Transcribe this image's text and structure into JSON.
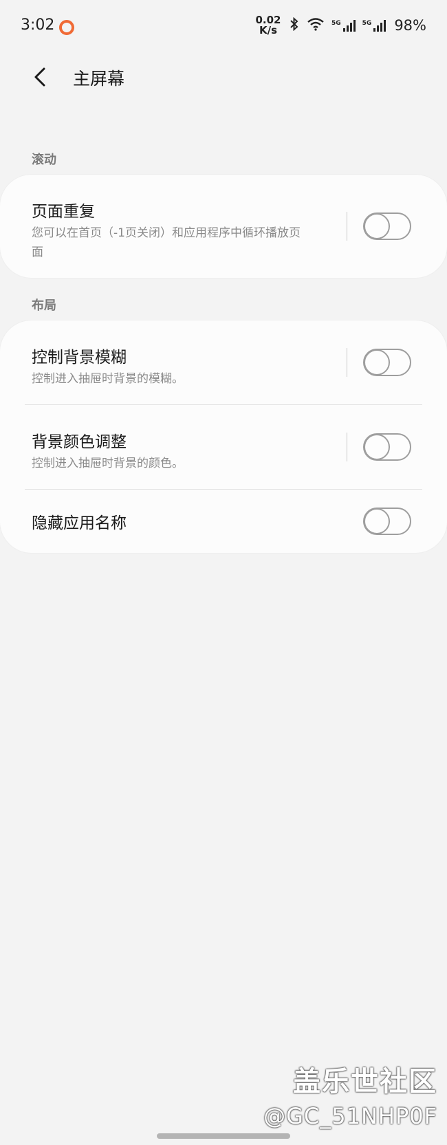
{
  "status_bar": {
    "time": "3:02",
    "net_speed_value": "0.02",
    "net_speed_unit": "K/s",
    "signal1_label": "5G",
    "signal2_label": "5G",
    "battery": "98%",
    "notification_icon": "ring-notification-icon",
    "accent_color": "#f06a35"
  },
  "header": {
    "title": "主屏幕",
    "back_icon": "chevron-left-icon"
  },
  "sections": [
    {
      "label": "滚动",
      "items": [
        {
          "title": "页面重复",
          "desc_line1": "您可以在首页（-1页关闭）和应用程序中循环播放页",
          "desc_line2": "面",
          "enabled": false
        }
      ]
    },
    {
      "label": "布局",
      "items": [
        {
          "title": "控制背景模糊",
          "desc": "控制进入抽屉时背景的模糊。",
          "enabled": false
        },
        {
          "title": "背景颜色调整",
          "desc": "控制进入抽屉时背景的颜色。",
          "enabled": false
        },
        {
          "title": "隐藏应用名称",
          "enabled": false
        }
      ]
    }
  ],
  "watermark": {
    "brand": "盖乐世社区",
    "user": "@GC_51NHP0F"
  }
}
